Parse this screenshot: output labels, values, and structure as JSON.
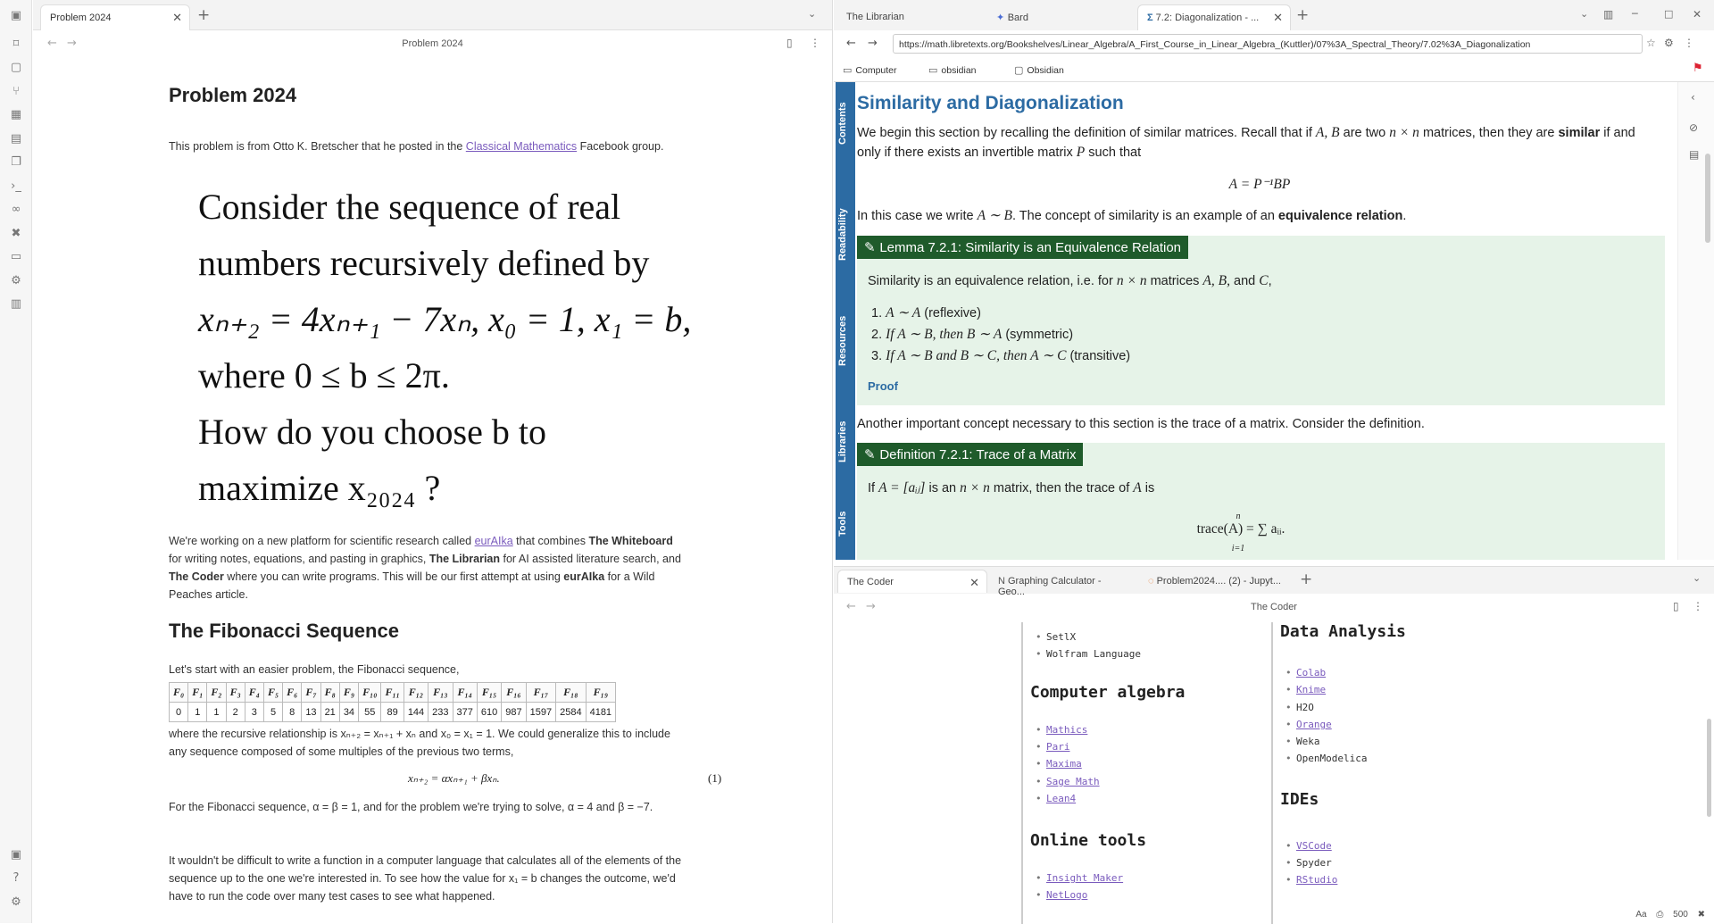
{
  "left_tab": {
    "label": "Problem 2024"
  },
  "left_nav": {
    "title": "Problem 2024"
  },
  "note": {
    "title": "Problem 2024",
    "intro_pre": "This problem is from Otto K. Bretscher that he posted in the ",
    "intro_link": "Classical Mathematics",
    "intro_post": " Facebook group.",
    "big_lines": [
      "Consider the sequence of real",
      "numbers recursively defined by",
      "xₙ₊₂ = 4xₙ₊₁ − 7xₙ, x₀ = 1, x₁ = b,",
      "where 0 ≤ b ≤ 2π.",
      "How do you choose b to",
      "maximize x₂₀₂₄ ?"
    ],
    "platform_pre": "We're working on a new platform for scientific research called ",
    "platform_link": "eurAIka",
    "platform_1": " that combines ",
    "whiteboard": "The Whiteboard",
    "platform_2": " for writing notes, equations, and pasting in graphics, ",
    "librarian": "The Librarian",
    "platform_3": " for AI assisted literature search, and ",
    "coder": "The Coder",
    "platform_4": " where you can write programs. This will be our first attempt at using ",
    "eurAIka_bold": "eurAIka",
    "platform_5": " for a Wild Peaches article.",
    "fib_heading": "The Fibonacci Sequence",
    "fib_intro": "Let's start with an easier problem, the Fibonacci sequence,",
    "fib_headers": [
      "F₀",
      "F₁",
      "F₂",
      "F₃",
      "F₄",
      "F₅",
      "F₆",
      "F₇",
      "F₈",
      "F₉",
      "F₁₀",
      "F₁₁",
      "F₁₂",
      "F₁₃",
      "F₁₄",
      "F₁₅",
      "F₁₆",
      "F₁₇",
      "F₁₈",
      "F₁₉"
    ],
    "fib_values": [
      "0",
      "1",
      "1",
      "2",
      "3",
      "5",
      "8",
      "13",
      "21",
      "34",
      "55",
      "89",
      "144",
      "233",
      "377",
      "610",
      "987",
      "1597",
      "2584",
      "4181"
    ],
    "rec_text": "where the recursive relationship is xₙ₊₂ = xₙ₊₁ + xₙ and x₀ = x₁ = 1. We could generalize this to include any sequence composed of some multiples of the previous two terms,",
    "gen_eq": "xₙ₊₂ = αxₙ₊₁ + βxₙ.",
    "gen_eq_num": "(1)",
    "fib_params": "For the Fibonacci sequence, α = β = 1, and for the problem we're trying to solve, α = 4 and β = −7.",
    "last_para": "It wouldn't be difficult to write a function in a computer language that calculates all of the elements of the sequence up to the one we're interested in. To see how the value for x₁ = b changes the outcome, we'd have to run the code over many test cases to see what happened."
  },
  "right_tabs": [
    "The Librarian",
    "Bard",
    "7.2: Diagonalization - ..."
  ],
  "url": "https://math.libretexts.org/Bookshelves/Linear_Algebra/A_First_Course_in_Linear_Algebra_(Kuttler)/07%3A_Spectral_Theory/7.02%3A_Diagonalization",
  "bookmarks": [
    "Computer",
    "obsidian",
    "Obsidian"
  ],
  "vertical_tabs": [
    "Contents",
    "Readability",
    "Resources",
    "Libraries",
    "Tools"
  ],
  "libre": {
    "title": "Similarity and Diagonalization",
    "p1_a": "We begin this section by recalling the definition of similar matrices. Recall that if ",
    "p1_m1": "A, B",
    "p1_b": " are two ",
    "p1_m2": "n × n",
    "p1_c": " matrices, then they are ",
    "p1_bold": "similar",
    "p1_d": " if and only if there exists an invertible matrix ",
    "p1_m3": "P",
    "p1_e": " such that",
    "eq1": "A = P⁻¹BP",
    "p2_a": "In this case we write ",
    "p2_m": "A ∼ B",
    "p2_b": ". The concept of similarity is an example of an ",
    "p2_bold": "equivalence relation",
    "p2_c": ".",
    "lemma_title": "Lemma 7.2.1: Similarity is an Equivalence Relation",
    "lemma_text_a": "Similarity is an equivalence relation, i.e. for ",
    "lemma_m1": "n × n",
    "lemma_text_b": " matrices ",
    "lemma_m2": "A, B,",
    "lemma_text_c": " and ",
    "lemma_m3": "C",
    "lemma_text_d": ",",
    "lemma_items": [
      {
        "n": "1.",
        "m": "A ∼ A",
        "t": " (reflexive)"
      },
      {
        "n": "2.",
        "m": "If A ∼ B, then B ∼ A",
        "t": " (symmetric)"
      },
      {
        "n": "3.",
        "m": "If A ∼ B and B ∼ C, then A ∼ C",
        "t": " (transitive)"
      }
    ],
    "proof": "Proof",
    "p3": "Another important concept necessary to this section is the trace of a matrix. Consider the definition.",
    "def_title": "Definition 7.2.1: Trace of a Matrix",
    "def_text_a": "If ",
    "def_m1": "A = [aᵢⱼ]",
    "def_text_b": " is an ",
    "def_m2": "n × n",
    "def_text_c": " matrix, then the trace of ",
    "def_m3": "A",
    "def_text_d": " is",
    "trace_eq": "trace(A) = ∑ aᵢᵢ.",
    "trace_top": "n",
    "trace_bot": "i=1"
  },
  "coder_tabs": [
    "The Coder",
    "Graphing Calculator - Geo...",
    "Problem2024.... (2) - Jupyt..."
  ],
  "coder_title": "The Coder",
  "coder": {
    "colA_top": [
      "SetlX",
      "Wolfram Language"
    ],
    "h_algebra": "Computer algebra",
    "algebra": [
      "Mathics",
      "Pari",
      "Maxima",
      "Sage Math",
      "Lean4"
    ],
    "h_online": "Online tools",
    "online": [
      "Insight Maker",
      "NetLogo"
    ],
    "h_data": "Data Analysis",
    "data": [
      {
        "t": "Colab",
        "link": true
      },
      {
        "t": "Knime",
        "link": true
      },
      {
        "t": "H2O",
        "link": false
      },
      {
        "t": "Orange",
        "link": true
      },
      {
        "t": "Weka",
        "link": false
      },
      {
        "t": "OpenModelica",
        "link": false
      }
    ],
    "h_ides": "IDEs",
    "ides": [
      {
        "t": "VSCode",
        "link": true
      },
      {
        "t": "Spyder",
        "link": false
      },
      {
        "t": "RStudio",
        "link": true
      }
    ]
  },
  "status": {
    "zoom": "500"
  }
}
